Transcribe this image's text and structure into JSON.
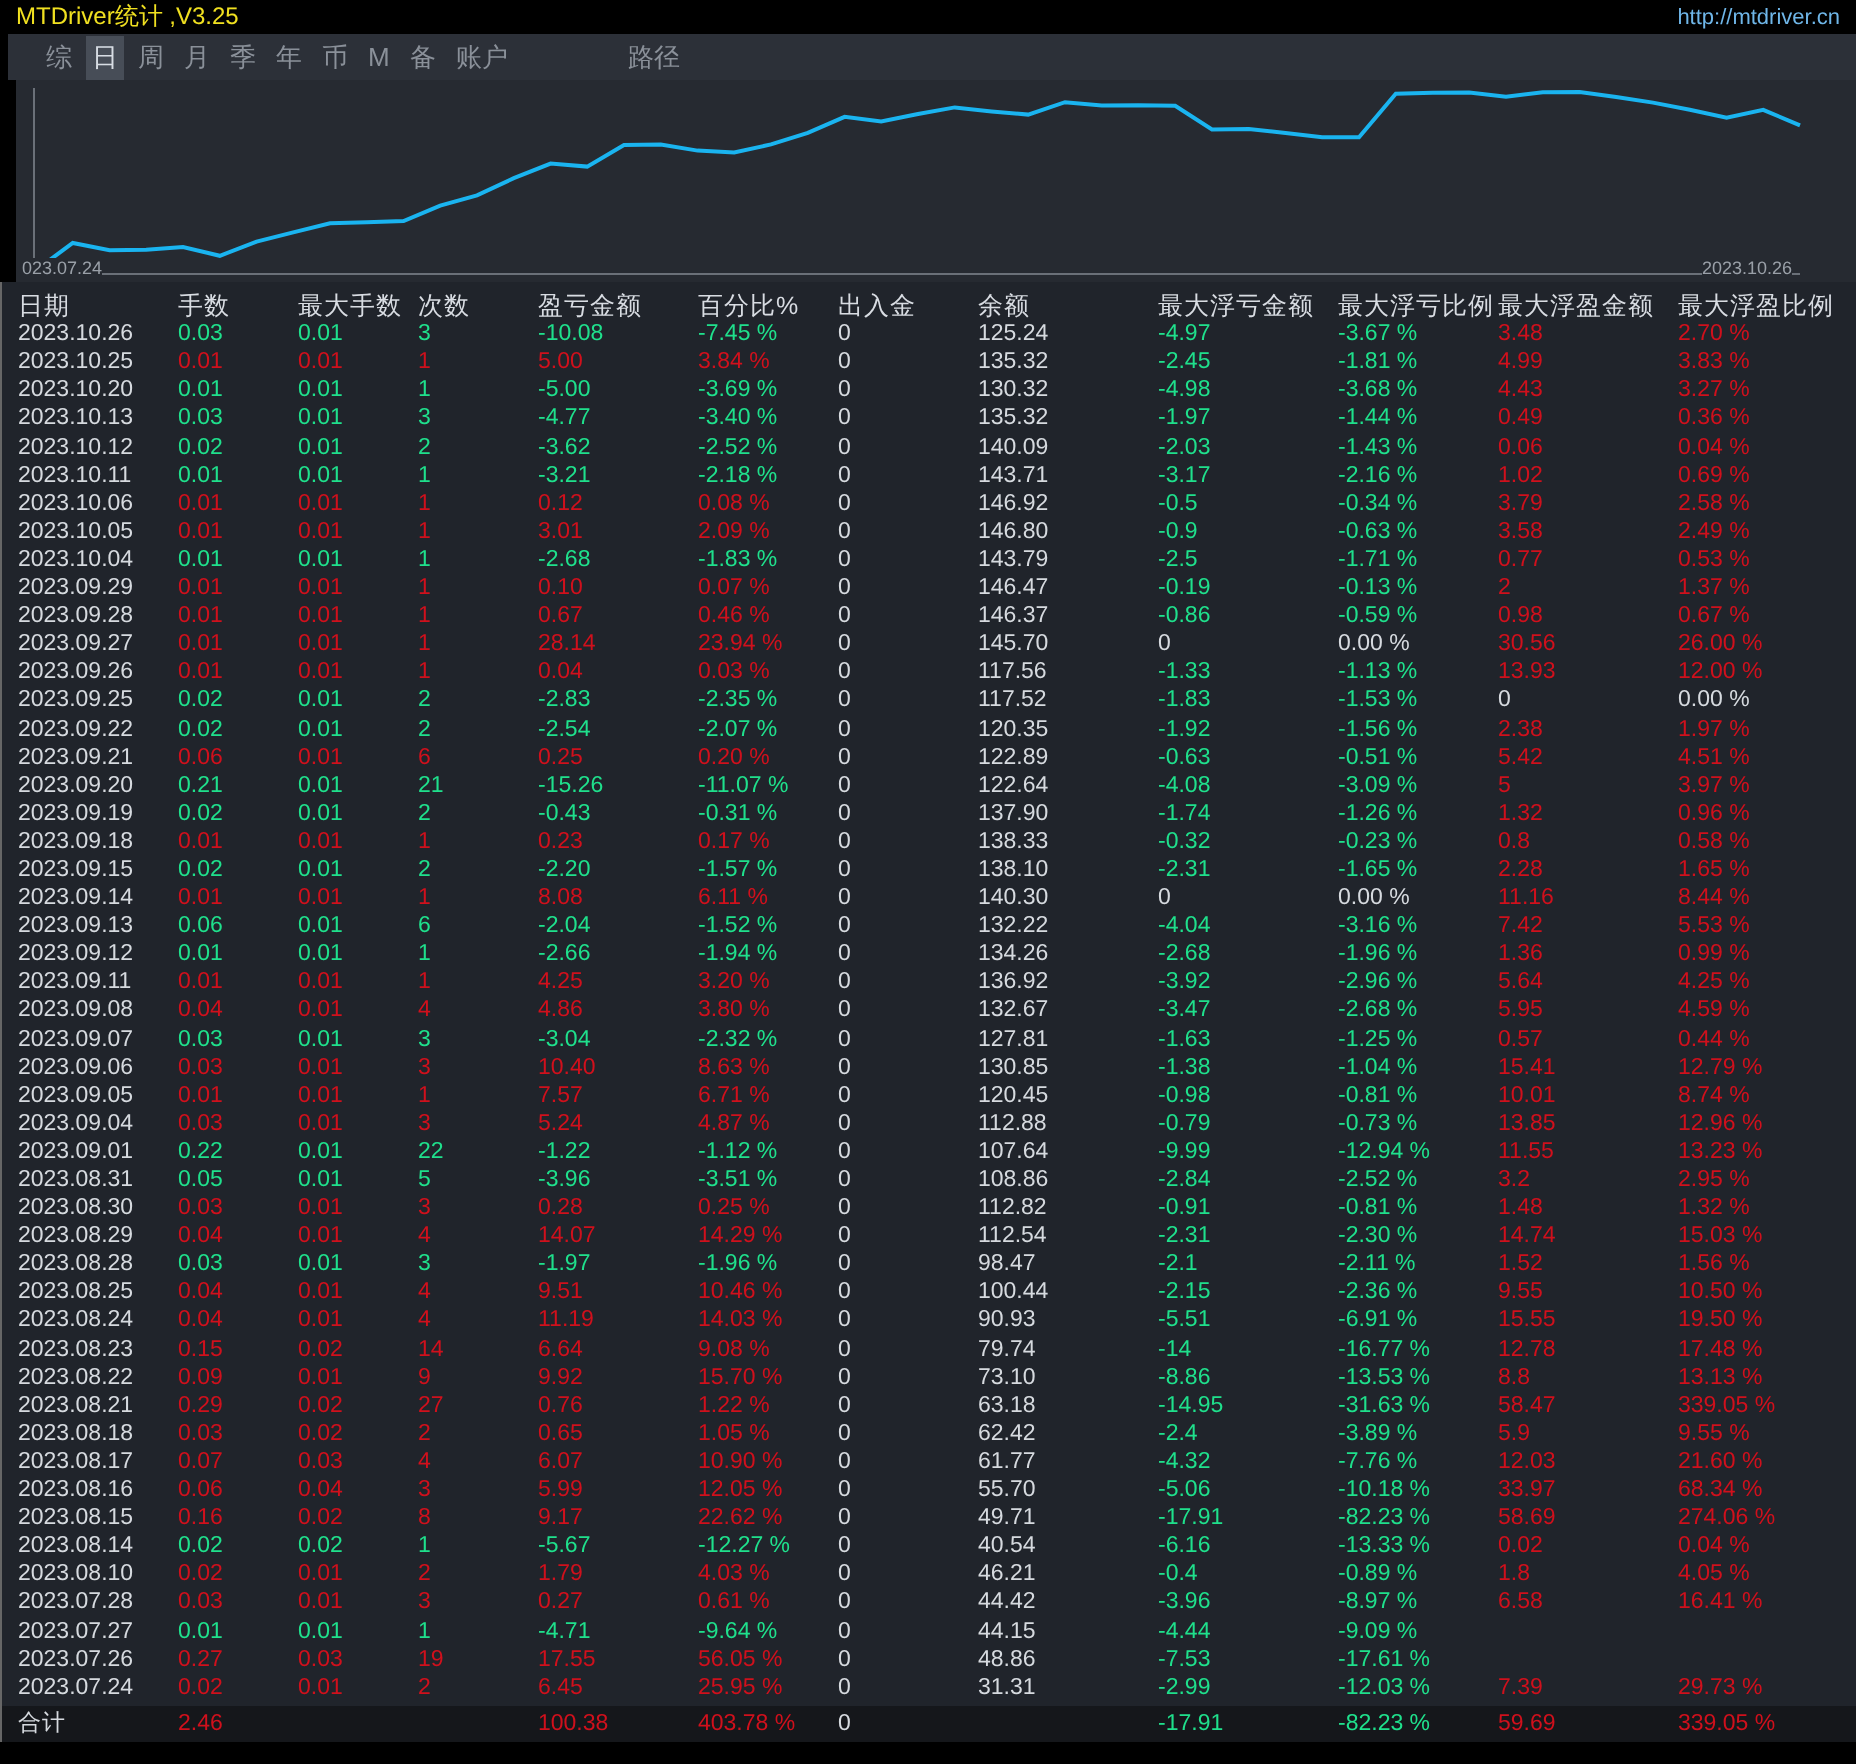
{
  "window": {
    "title": "MTDriver统计 ,V3.25",
    "url": "http://mtdriver.cn"
  },
  "tabs": [
    {
      "label": "综",
      "selected": false
    },
    {
      "label": "日",
      "selected": true
    },
    {
      "label": "周",
      "selected": false
    },
    {
      "label": "月",
      "selected": false
    },
    {
      "label": "季",
      "selected": false
    },
    {
      "label": "年",
      "selected": false
    },
    {
      "label": "币",
      "selected": false
    },
    {
      "label": "M",
      "selected": false
    },
    {
      "label": "备",
      "selected": false
    },
    {
      "label": "账户",
      "selected": false
    }
  ],
  "path_tab": {
    "label": "路径"
  },
  "chart": {
    "start_label": "023.07.24",
    "end_label": "2023.10.26"
  },
  "table": {
    "columns": [
      "日期",
      "手数",
      "最大手数",
      "次数",
      "盈亏金额",
      "百分比%",
      "出入金",
      "余额",
      "最大浮亏金额",
      "最大浮亏比例",
      "最大浮盈金额",
      "最大浮盈比例"
    ],
    "rows": [
      {
        "color": "#1fe08c",
        "cells": [
          "2023.10.26",
          "0.03",
          "0.01",
          "3",
          "-10.08",
          "-7.45 %",
          "0",
          "125.24",
          "-4.97",
          "-3.67 %",
          "3.48",
          "2.70 %"
        ]
      },
      {
        "color": "#d0101c",
        "cells": [
          "2023.10.25",
          "0.01",
          "0.01",
          "1",
          "5.00",
          "3.84 %",
          "0",
          "135.32",
          "-2.45",
          "-1.81 %",
          "4.99",
          "3.83 %"
        ]
      },
      {
        "color": "#1fe08c",
        "cells": [
          "2023.10.20",
          "0.01",
          "0.01",
          "1",
          "-5.00",
          "-3.69 %",
          "0",
          "130.32",
          "-4.98",
          "-3.68 %",
          "4.43",
          "3.27 %"
        ]
      },
      {
        "color": "#1fe08c",
        "cells": [
          "2023.10.13",
          "0.03",
          "0.01",
          "3",
          "-4.77",
          "-3.40 %",
          "0",
          "135.32",
          "-1.97",
          "-1.44 %",
          "0.49",
          "0.36 %"
        ]
      },
      {
        "color": "#1fe08c",
        "cells": [
          "2023.10.12",
          "0.02",
          "0.01",
          "2",
          "-3.62",
          "-2.52 %",
          "0",
          "140.09",
          "-2.03",
          "-1.43 %",
          "0.06",
          "0.04 %"
        ]
      },
      {
        "color": "#1fe08c",
        "cells": [
          "2023.10.11",
          "0.01",
          "0.01",
          "1",
          "-3.21",
          "-2.18 %",
          "0",
          "143.71",
          "-3.17",
          "-2.16 %",
          "1.02",
          "0.69 %"
        ]
      },
      {
        "color": "#d0101c",
        "cells": [
          "2023.10.06",
          "0.01",
          "0.01",
          "1",
          "0.12",
          "0.08 %",
          "0",
          "146.92",
          "-0.5",
          "-0.34 %",
          "3.79",
          "2.58 %"
        ]
      },
      {
        "color": "#d0101c",
        "cells": [
          "2023.10.05",
          "0.01",
          "0.01",
          "1",
          "3.01",
          "2.09 %",
          "0",
          "146.80",
          "-0.9",
          "-0.63 %",
          "3.58",
          "2.49 %"
        ]
      },
      {
        "color": "#1fe08c",
        "cells": [
          "2023.10.04",
          "0.01",
          "0.01",
          "1",
          "-2.68",
          "-1.83 %",
          "0",
          "143.79",
          "-2.5",
          "-1.71 %",
          "0.77",
          "0.53 %"
        ]
      },
      {
        "color": "#d0101c",
        "cells": [
          "2023.09.29",
          "0.01",
          "0.01",
          "1",
          "0.10",
          "0.07 %",
          "0",
          "146.47",
          "-0.19",
          "-0.13 %",
          "2",
          "1.37 %"
        ]
      },
      {
        "color": "#d0101c",
        "cells": [
          "2023.09.28",
          "0.01",
          "0.01",
          "1",
          "0.67",
          "0.46 %",
          "0",
          "146.37",
          "-0.86",
          "-0.59 %",
          "0.98",
          "0.67 %"
        ]
      },
      {
        "color": "#d0101c",
        "loss_flat": true,
        "cells": [
          "2023.09.27",
          "0.01",
          "0.01",
          "1",
          "28.14",
          "23.94 %",
          "0",
          "145.70",
          "0",
          "0.00 %",
          "30.56",
          "26.00 %"
        ]
      },
      {
        "color": "#d0101c",
        "cells": [
          "2023.09.26",
          "0.01",
          "0.01",
          "1",
          "0.04",
          "0.03 %",
          "0",
          "117.56",
          "-1.33",
          "-1.13 %",
          "13.93",
          "12.00 %"
        ]
      },
      {
        "color": "#1fe08c",
        "gain_flat": true,
        "cells": [
          "2023.09.25",
          "0.02",
          "0.01",
          "2",
          "-2.83",
          "-2.35 %",
          "0",
          "117.52",
          "-1.83",
          "-1.53 %",
          "0",
          "0.00 %"
        ]
      },
      {
        "color": "#1fe08c",
        "cells": [
          "2023.09.22",
          "0.02",
          "0.01",
          "2",
          "-2.54",
          "-2.07 %",
          "0",
          "120.35",
          "-1.92",
          "-1.56 %",
          "2.38",
          "1.97 %"
        ]
      },
      {
        "color": "#d0101c",
        "cells": [
          "2023.09.21",
          "0.06",
          "0.01",
          "6",
          "0.25",
          "0.20 %",
          "0",
          "122.89",
          "-0.63",
          "-0.51 %",
          "5.42",
          "4.51 %"
        ]
      },
      {
        "color": "#1fe08c",
        "cells": [
          "2023.09.20",
          "0.21",
          "0.01",
          "21",
          "-15.26",
          "-11.07 %",
          "0",
          "122.64",
          "-4.08",
          "-3.09 %",
          "5",
          "3.97 %"
        ]
      },
      {
        "color": "#1fe08c",
        "cells": [
          "2023.09.19",
          "0.02",
          "0.01",
          "2",
          "-0.43",
          "-0.31 %",
          "0",
          "137.90",
          "-1.74",
          "-1.26 %",
          "1.32",
          "0.96 %"
        ]
      },
      {
        "color": "#d0101c",
        "cells": [
          "2023.09.18",
          "0.01",
          "0.01",
          "1",
          "0.23",
          "0.17 %",
          "0",
          "138.33",
          "-0.32",
          "-0.23 %",
          "0.8",
          "0.58 %"
        ]
      },
      {
        "color": "#1fe08c",
        "cells": [
          "2023.09.15",
          "0.02",
          "0.01",
          "2",
          "-2.20",
          "-1.57 %",
          "0",
          "138.10",
          "-2.31",
          "-1.65 %",
          "2.28",
          "1.65 %"
        ]
      },
      {
        "color": "#d0101c",
        "loss_flat": true,
        "cells": [
          "2023.09.14",
          "0.01",
          "0.01",
          "1",
          "8.08",
          "6.11 %",
          "0",
          "140.30",
          "0",
          "0.00 %",
          "11.16",
          "8.44 %"
        ]
      },
      {
        "color": "#1fe08c",
        "cells": [
          "2023.09.13",
          "0.06",
          "0.01",
          "6",
          "-2.04",
          "-1.52 %",
          "0",
          "132.22",
          "-4.04",
          "-3.16 %",
          "7.42",
          "5.53 %"
        ]
      },
      {
        "color": "#1fe08c",
        "cells": [
          "2023.09.12",
          "0.01",
          "0.01",
          "1",
          "-2.66",
          "-1.94 %",
          "0",
          "134.26",
          "-2.68",
          "-1.96 %",
          "1.36",
          "0.99 %"
        ]
      },
      {
        "color": "#d0101c",
        "cells": [
          "2023.09.11",
          "0.01",
          "0.01",
          "1",
          "4.25",
          "3.20 %",
          "0",
          "136.92",
          "-3.92",
          "-2.96 %",
          "5.64",
          "4.25 %"
        ]
      },
      {
        "color": "#d0101c",
        "cells": [
          "2023.09.08",
          "0.04",
          "0.01",
          "4",
          "4.86",
          "3.80 %",
          "0",
          "132.67",
          "-3.47",
          "-2.68 %",
          "5.95",
          "4.59 %"
        ]
      },
      {
        "color": "#1fe08c",
        "cells": [
          "2023.09.07",
          "0.03",
          "0.01",
          "3",
          "-3.04",
          "-2.32 %",
          "0",
          "127.81",
          "-1.63",
          "-1.25 %",
          "0.57",
          "0.44 %"
        ]
      },
      {
        "color": "#d0101c",
        "cells": [
          "2023.09.06",
          "0.03",
          "0.01",
          "3",
          "10.40",
          "8.63 %",
          "0",
          "130.85",
          "-1.38",
          "-1.04 %",
          "15.41",
          "12.79 %"
        ]
      },
      {
        "color": "#d0101c",
        "cells": [
          "2023.09.05",
          "0.01",
          "0.01",
          "1",
          "7.57",
          "6.71 %",
          "0",
          "120.45",
          "-0.98",
          "-0.81 %",
          "10.01",
          "8.74 %"
        ]
      },
      {
        "color": "#d0101c",
        "cells": [
          "2023.09.04",
          "0.03",
          "0.01",
          "3",
          "5.24",
          "4.87 %",
          "0",
          "112.88",
          "-0.79",
          "-0.73 %",
          "13.85",
          "12.96 %"
        ]
      },
      {
        "color": "#1fe08c",
        "cells": [
          "2023.09.01",
          "0.22",
          "0.01",
          "22",
          "-1.22",
          "-1.12 %",
          "0",
          "107.64",
          "-9.99",
          "-12.94 %",
          "11.55",
          "13.23 %"
        ]
      },
      {
        "color": "#1fe08c",
        "cells": [
          "2023.08.31",
          "0.05",
          "0.01",
          "5",
          "-3.96",
          "-3.51 %",
          "0",
          "108.86",
          "-2.84",
          "-2.52 %",
          "3.2",
          "2.95 %"
        ]
      },
      {
        "color": "#d0101c",
        "cells": [
          "2023.08.30",
          "0.03",
          "0.01",
          "3",
          "0.28",
          "0.25 %",
          "0",
          "112.82",
          "-0.91",
          "-0.81 %",
          "1.48",
          "1.32 %"
        ]
      },
      {
        "color": "#d0101c",
        "cells": [
          "2023.08.29",
          "0.04",
          "0.01",
          "4",
          "14.07",
          "14.29 %",
          "0",
          "112.54",
          "-2.31",
          "-2.30 %",
          "14.74",
          "15.03 %"
        ]
      },
      {
        "color": "#1fe08c",
        "cells": [
          "2023.08.28",
          "0.03",
          "0.01",
          "3",
          "-1.97",
          "-1.96 %",
          "0",
          "98.47",
          "-2.1",
          "-2.11 %",
          "1.52",
          "1.56 %"
        ]
      },
      {
        "color": "#d0101c",
        "cells": [
          "2023.08.25",
          "0.04",
          "0.01",
          "4",
          "9.51",
          "10.46 %",
          "0",
          "100.44",
          "-2.15",
          "-2.36 %",
          "9.55",
          "10.50 %"
        ]
      },
      {
        "color": "#d0101c",
        "cells": [
          "2023.08.24",
          "0.04",
          "0.01",
          "4",
          "11.19",
          "14.03 %",
          "0",
          "90.93",
          "-5.51",
          "-6.91 %",
          "15.55",
          "19.50 %"
        ]
      },
      {
        "color": "#d0101c",
        "cells": [
          "2023.08.23",
          "0.15",
          "0.02",
          "14",
          "6.64",
          "9.08 %",
          "0",
          "79.74",
          "-14",
          "-16.77 %",
          "12.78",
          "17.48 %"
        ]
      },
      {
        "color": "#d0101c",
        "cells": [
          "2023.08.22",
          "0.09",
          "0.01",
          "9",
          "9.92",
          "15.70 %",
          "0",
          "73.10",
          "-8.86",
          "-13.53 %",
          "8.8",
          "13.13 %"
        ]
      },
      {
        "color": "#d0101c",
        "cells": [
          "2023.08.21",
          "0.29",
          "0.02",
          "27",
          "0.76",
          "1.22 %",
          "0",
          "63.18",
          "-14.95",
          "-31.63 %",
          "58.47",
          "339.05 %"
        ]
      },
      {
        "color": "#d0101c",
        "cells": [
          "2023.08.18",
          "0.03",
          "0.02",
          "2",
          "0.65",
          "1.05 %",
          "0",
          "62.42",
          "-2.4",
          "-3.89 %",
          "5.9",
          "9.55 %"
        ]
      },
      {
        "color": "#d0101c",
        "cells": [
          "2023.08.17",
          "0.07",
          "0.03",
          "4",
          "6.07",
          "10.90 %",
          "0",
          "61.77",
          "-4.32",
          "-7.76 %",
          "12.03",
          "21.60 %"
        ]
      },
      {
        "color": "#d0101c",
        "cells": [
          "2023.08.16",
          "0.06",
          "0.04",
          "3",
          "5.99",
          "12.05 %",
          "0",
          "55.70",
          "-5.06",
          "-10.18 %",
          "33.97",
          "68.34 %"
        ]
      },
      {
        "color": "#d0101c",
        "cells": [
          "2023.08.15",
          "0.16",
          "0.02",
          "8",
          "9.17",
          "22.62 %",
          "0",
          "49.71",
          "-17.91",
          "-82.23 %",
          "58.69",
          "274.06 %"
        ]
      },
      {
        "color": "#1fe08c",
        "cells": [
          "2023.08.14",
          "0.02",
          "0.02",
          "1",
          "-5.67",
          "-12.27 %",
          "0",
          "40.54",
          "-6.16",
          "-13.33 %",
          "0.02",
          "0.04 %"
        ]
      },
      {
        "color": "#d0101c",
        "cells": [
          "2023.08.10",
          "0.02",
          "0.01",
          "2",
          "1.79",
          "4.03 %",
          "0",
          "46.21",
          "-0.4",
          "-0.89 %",
          "1.8",
          "4.05 %"
        ]
      },
      {
        "color": "#d0101c",
        "cells": [
          "2023.07.28",
          "0.03",
          "0.01",
          "3",
          "0.27",
          "0.61 %",
          "0",
          "44.42",
          "-3.96",
          "-8.97 %",
          "6.58",
          "16.41 %"
        ]
      },
      {
        "color": "#1fe08c",
        "cells": [
          "2023.07.27",
          "0.01",
          "0.01",
          "1",
          "-4.71",
          "-9.64 %",
          "0",
          "44.15",
          "-4.44",
          "-9.09 %"
        ]
      },
      {
        "color": "#d0101c",
        "cells": [
          "2023.07.26",
          "0.27",
          "0.03",
          "19",
          "17.55",
          "56.05 %",
          "0",
          "48.86",
          "-7.53",
          "-17.61 %"
        ]
      },
      {
        "color": "#d0101c",
        "cells": [
          "2023.07.24",
          "0.02",
          "0.01",
          "2",
          "6.45",
          "25.95 %",
          "0",
          "31.31",
          "-2.99",
          "-12.03 %",
          "7.39",
          "29.73 %"
        ]
      }
    ],
    "total": {
      "label": "合计",
      "lots": "2.46",
      "pnl": "100.38",
      "pct": "403.78 %",
      "flow": "0",
      "float_loss": "-17.91",
      "float_loss_pct": "-82.23 %",
      "float_gain": "59.69",
      "float_gain_pct": "339.05 %"
    }
  }
}
